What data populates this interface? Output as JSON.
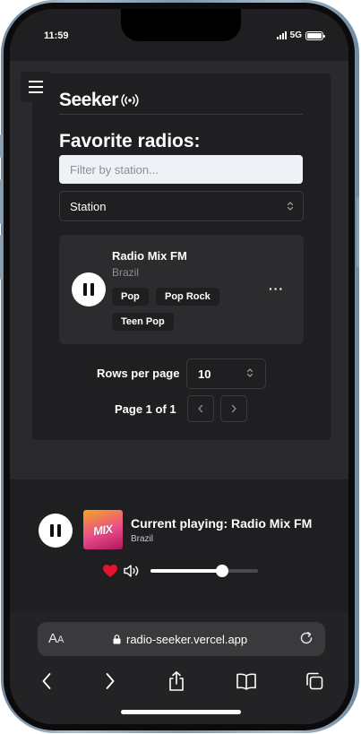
{
  "status_bar": {
    "time": "11:59",
    "network": "5G"
  },
  "app": {
    "logo": "Seeker",
    "heading": "Favorite radios:",
    "filter": {
      "placeholder": "Filter by station..."
    },
    "sort_select": {
      "value": "Station"
    },
    "radios": [
      {
        "name": "Radio Mix FM",
        "country": "Brazil",
        "tags": [
          "Pop",
          "Pop Rock",
          "Teen Pop"
        ],
        "more_label": "···"
      }
    ],
    "pagination": {
      "rows_label": "Rows per page",
      "rows_value": "10",
      "page_label": "Page 1 of 1"
    }
  },
  "player": {
    "cover_text": "MIX",
    "title": "Current playing: Radio Mix FM",
    "country": "Brazil",
    "volume": 0.67,
    "favorite_color": "#e5142c"
  },
  "browser": {
    "aa_label": "A",
    "aa_small": "A",
    "url": "radio-seeker.vercel.app"
  },
  "icons": {
    "menu": "menu-icon",
    "radio_waves": "radio-waves-icon",
    "pause": "pause-icon",
    "heart": "heart-icon",
    "speaker": "speaker-icon",
    "lock": "lock-icon",
    "reload": "reload-icon",
    "back": "chevron-left-icon",
    "forward": "chevron-right-icon",
    "share": "share-icon",
    "bookmarks": "book-icon",
    "tabs": "tabs-icon"
  }
}
